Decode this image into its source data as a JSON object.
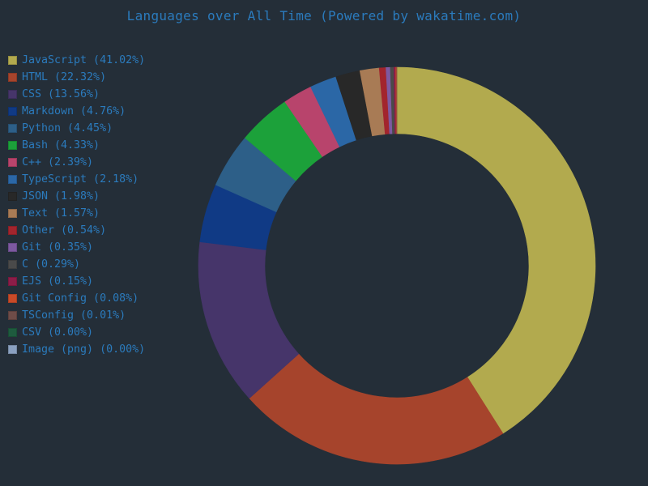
{
  "chart_data": {
    "type": "pie",
    "title": "Languages over All Time (Powered by wakatime.com)",
    "legend_position": "left",
    "slices": [
      {
        "label": "JavaScript (41.02%)",
        "value": 41.02,
        "color": "#b2aa4e"
      },
      {
        "label": "HTML (22.32%)",
        "value": 22.32,
        "color": "#a6442c"
      },
      {
        "label": "CSS (13.56%)",
        "value": 13.56,
        "color": "#46356a"
      },
      {
        "label": "Markdown (4.76%)",
        "value": 4.76,
        "color": "#103a85"
      },
      {
        "label": "Python (4.45%)",
        "value": 4.45,
        "color": "#2d5f88"
      },
      {
        "label": "Bash (4.33%)",
        "value": 4.33,
        "color": "#1ca13a"
      },
      {
        "label": "C++ (2.39%)",
        "value": 2.39,
        "color": "#b8446c"
      },
      {
        "label": "TypeScript (2.18%)",
        "value": 2.18,
        "color": "#2b67a6"
      },
      {
        "label": "JSON (1.98%)",
        "value": 1.98,
        "color": "#282828"
      },
      {
        "label": "Text (1.57%)",
        "value": 1.57,
        "color": "#a87b55"
      },
      {
        "label": "Other (0.54%)",
        "value": 0.54,
        "color": "#a2252d"
      },
      {
        "label": "Git (0.35%)",
        "value": 0.35,
        "color": "#7d59a0"
      },
      {
        "label": "C (0.29%)",
        "value": 0.29,
        "color": "#4a4a4a"
      },
      {
        "label": "EJS (0.15%)",
        "value": 0.15,
        "color": "#8c1d48"
      },
      {
        "label": "Git Config (0.08%)",
        "value": 0.08,
        "color": "#c94a28"
      },
      {
        "label": "TSConfig (0.01%)",
        "value": 0.01,
        "color": "#6e4c48"
      },
      {
        "label": "CSV (0.00%)",
        "value": 0.0,
        "color": "#1e5b3e"
      },
      {
        "label": "Image (png) (0.00%)",
        "value": 0.0,
        "color": "#8aa0c0"
      }
    ]
  }
}
